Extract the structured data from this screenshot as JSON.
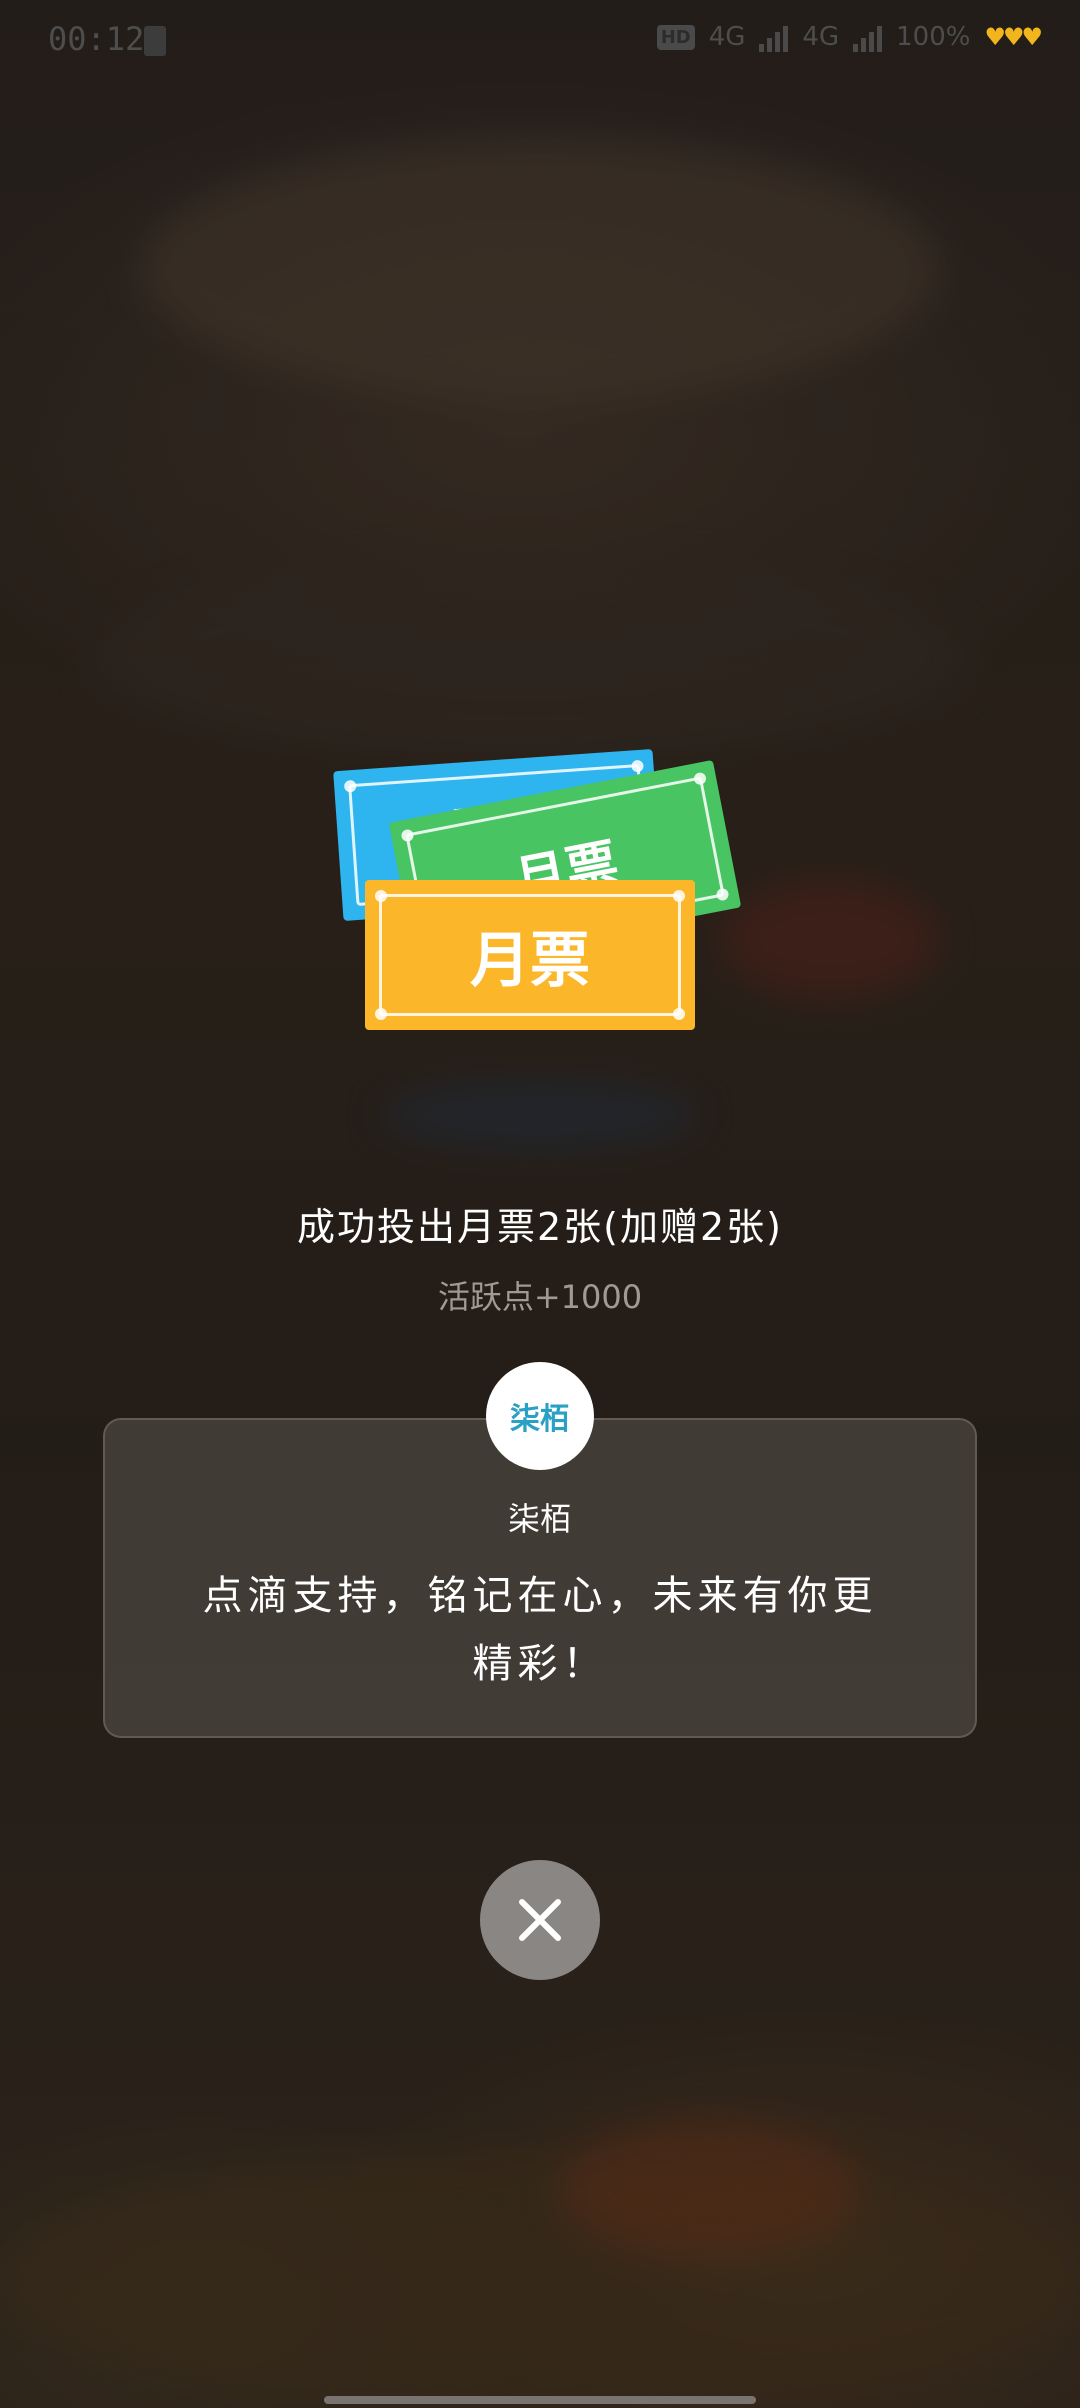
{
  "status_bar": {
    "time": "00:12",
    "hd": "HD",
    "network_1": "4G",
    "network_2": "4G",
    "battery": "100%",
    "hearts": "♥♥♥"
  },
  "tickets": {
    "label": "月票"
  },
  "result": {
    "title": "成功投出月票2张(加赠2张)",
    "bonus": "活跃点+1000"
  },
  "author": {
    "avatar_text": "柒栢",
    "name": "柒栢",
    "message": "点滴支持，铭记在心，未来有你更精彩！"
  },
  "colors": {
    "ticket_blue": "#2eb4ee",
    "ticket_green": "#48c462",
    "ticket_yellow": "#fbb62a"
  },
  "icons": {
    "close": "close-icon",
    "battery_status": "heart-icon"
  }
}
